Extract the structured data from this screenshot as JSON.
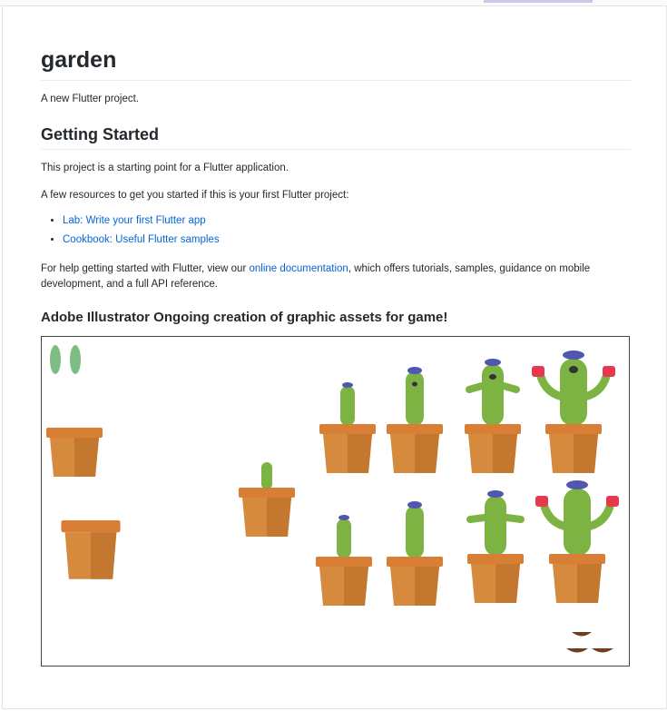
{
  "title": "garden",
  "description": "A new Flutter project.",
  "getting_started": {
    "heading": "Getting Started",
    "intro": "This project is a starting point for a Flutter application.",
    "resources_intro": "A few resources to get you started if this is your first Flutter project:",
    "links": [
      {
        "label": "Lab: Write your first Flutter app"
      },
      {
        "label": "Cookbook: Useful Flutter samples"
      }
    ],
    "help_prefix": "For help getting started with Flutter, view our ",
    "help_link": "online documentation",
    "help_suffix": ", which offers tutorials, samples, guidance on mobile development, and a full API reference."
  },
  "art_section": {
    "heading": "Adobe Illustrator Ongoing creation of graphic assets for game!"
  },
  "colors": {
    "pot_light": "#d68a3e",
    "pot_dark": "#c4782f",
    "pot_rim": "#d97e35",
    "cactus": "#7cb342",
    "cactus_dark": "#2e7d32",
    "leaf": "#7dbd85",
    "hair": "#4f57b0",
    "glove": "#e53950",
    "dirt": "#6d3f1e",
    "link": "#0366d6"
  }
}
